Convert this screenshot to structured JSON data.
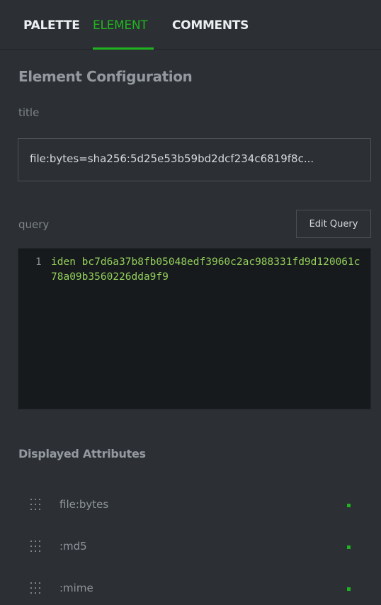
{
  "tabs": [
    {
      "label": "PALETTE",
      "active": false
    },
    {
      "label": "ELEMENT",
      "active": true
    },
    {
      "label": "COMMENTS",
      "active": false
    }
  ],
  "panel": {
    "heading": "Element Configuration",
    "title_label": "title",
    "title_value": "file:bytes=sha256:5d25e53b59bd2dcf234c6819f8c...",
    "query_label": "query",
    "edit_query_label": "Edit Query",
    "query_line_number": "1",
    "query_text": "iden bc7d6a37b8fb05048edf3960c2ac988331fd9d120061c78a09b3560226dda9f9"
  },
  "attributes": {
    "heading": "Displayed Attributes",
    "items": [
      {
        "label": "file:bytes",
        "enabled": true
      },
      {
        "label": ":md5",
        "enabled": true
      },
      {
        "label": ":mime",
        "enabled": true
      }
    ]
  },
  "colors": {
    "accent": "#1fb41f",
    "background": "#2c3034",
    "code_background": "#161a1d",
    "code_text": "#94cf5a"
  },
  "icons": {
    "drag_handle": "drag-handle-icon",
    "enabled_indicator": "green-square-indicator"
  }
}
